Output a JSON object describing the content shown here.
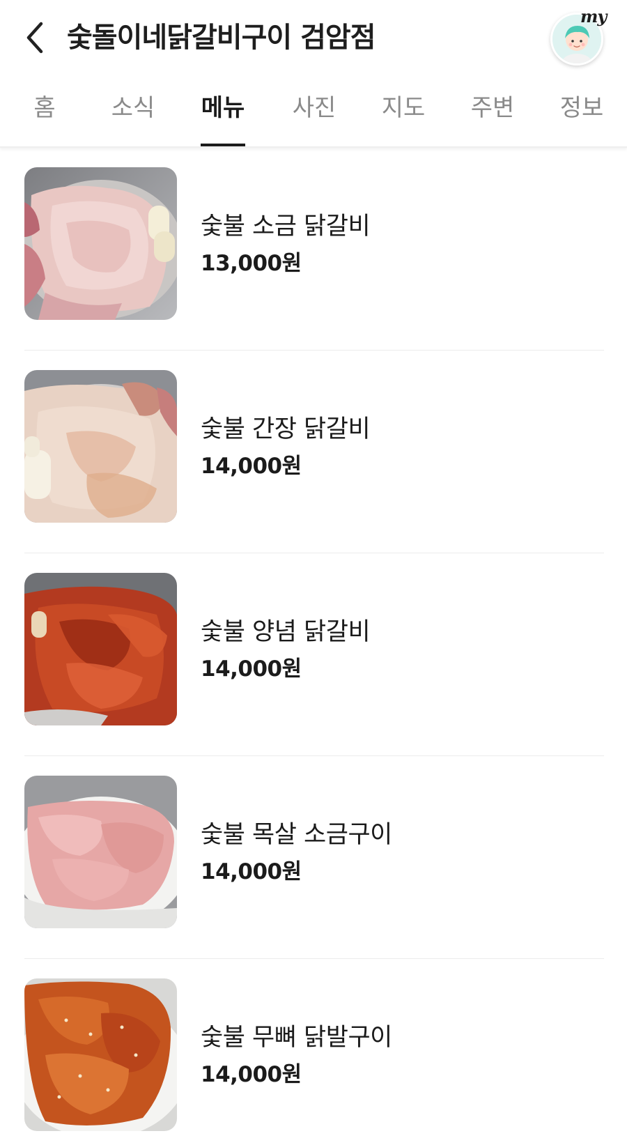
{
  "header": {
    "title": "숯돌이네닭갈비구이 검암점",
    "my_label": "my"
  },
  "tabs": [
    {
      "label": "홈",
      "active": false
    },
    {
      "label": "소식",
      "active": false
    },
    {
      "label": "메뉴",
      "active": true
    },
    {
      "label": "사진",
      "active": false
    },
    {
      "label": "지도",
      "active": false
    },
    {
      "label": "주변",
      "active": false
    },
    {
      "label": "정보",
      "active": false
    }
  ],
  "menu": {
    "items": [
      {
        "name": "숯불 소금 닭갈비",
        "price": "13,000원",
        "photo": "raw-salt-chicken-photo"
      },
      {
        "name": "숯불 간장 닭갈비",
        "price": "14,000원",
        "photo": "soy-chicken-photo"
      },
      {
        "name": "숯불 양념 닭갈비",
        "price": "14,000원",
        "photo": "spicy-chicken-photo"
      },
      {
        "name": "숯불 목살 소금구이",
        "price": "14,000원",
        "photo": "neck-meat-photo"
      },
      {
        "name": "숯불 무뼈 닭발구이",
        "price": "14,000원",
        "photo": "boneless-feet-photo"
      }
    ]
  },
  "colors": {
    "text_primary": "#1b1b1b",
    "tab_inactive": "#8a8a8a",
    "divider": "#ececec",
    "avatar_bg": "#dff3f1"
  }
}
